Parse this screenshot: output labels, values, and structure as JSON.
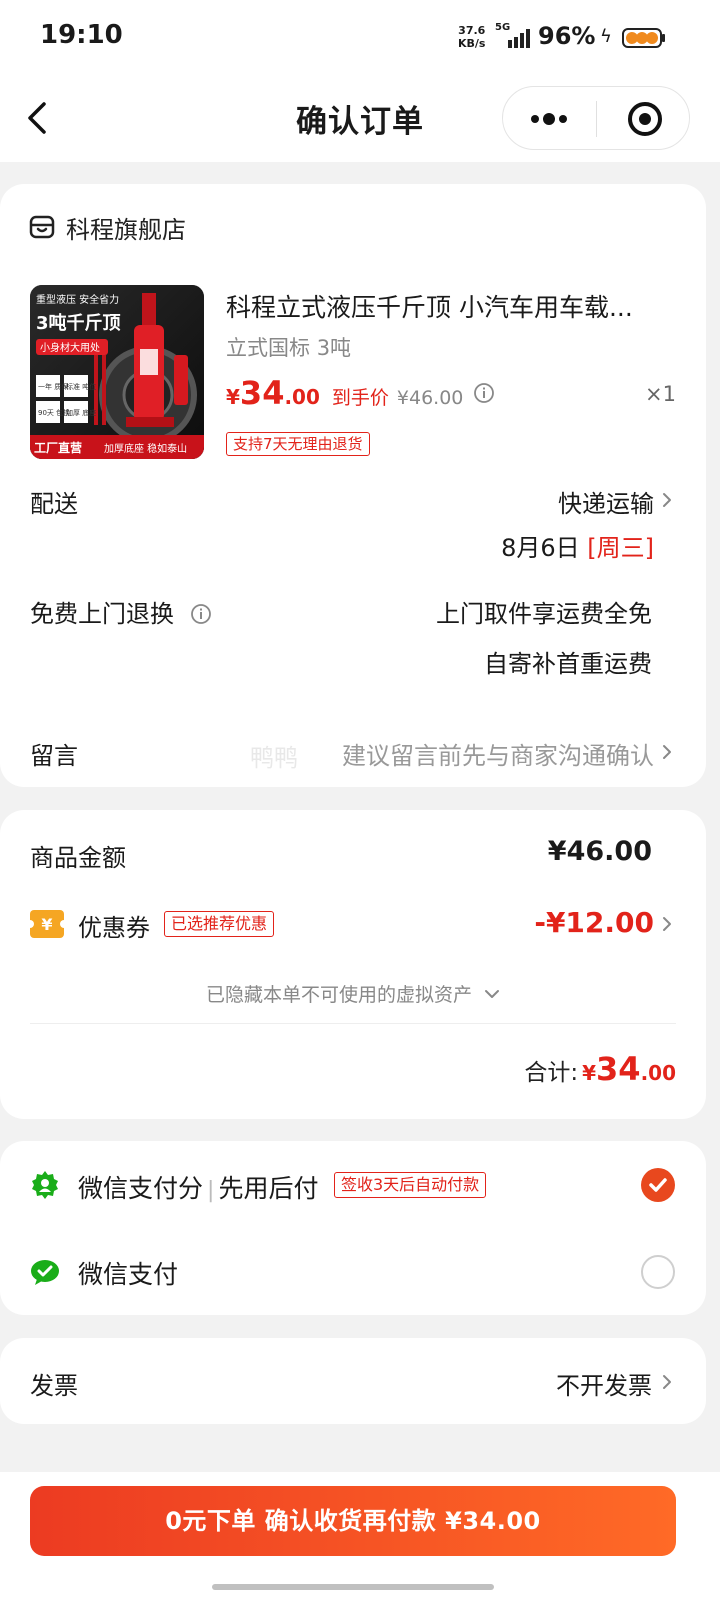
{
  "status_bar": {
    "time": "19:10",
    "net_speed_value": "37.6",
    "net_speed_unit": "KB/s",
    "network": "5G",
    "battery": "96%"
  },
  "nav": {
    "title": "确认订单",
    "more_icon": "more-dots-icon",
    "target_icon": "target-icon"
  },
  "shop": {
    "name": "科程旗舰店",
    "icon": "shop-icon"
  },
  "product": {
    "image_text": {
      "top": "重型液压 安全省力",
      "title": "3吨千斤顶",
      "sub": "小身材大用处",
      "f1": "一年\n质保",
      "f2": "标准\n吨位",
      "f3": "90天\n包换",
      "f4": "加厚\n底座",
      "banner_left": "工厂直营",
      "banner_right": "加厚底座 稳如泰山"
    },
    "title": "科程立式液压千斤顶 小汽车用车载...",
    "spec_prefix": "立式国标 ",
    "spec_bold": "3吨",
    "price_symbol": "¥",
    "price_int": "34",
    "price_dec": ".00",
    "final_price_label": "到手价",
    "final_price": "¥46.00",
    "quantity": "×1",
    "return_tag": "支持7天无理由退货"
  },
  "delivery": {
    "label": "配送",
    "method": "快递运输",
    "date": "8月6日",
    "weekday": "[周三]"
  },
  "free_return": {
    "label": "免费上门退换",
    "line1": "上门取件享运费全免",
    "line2": "自寄补首重运费"
  },
  "message": {
    "label": "留言",
    "placeholder": "建议留言前先与商家沟通确认",
    "watermark": "鸭鸭"
  },
  "amounts": {
    "goods_label": "商品金额",
    "goods_amount": "¥46.00",
    "coupon_label": "优惠券",
    "coupon_tag": "已选推荐优惠",
    "coupon_amount": "-¥12.00",
    "hidden_assets": "已隐藏本单不可使用的虚拟资产",
    "total_label": "合计:",
    "total_symbol": "¥",
    "total_int": "34",
    "total_dec": ".00"
  },
  "payment": {
    "option1": {
      "name": "微信支付分",
      "sub": "先用后付",
      "tag": "签收3天后自动付款",
      "selected": true
    },
    "option2": {
      "name": "微信支付",
      "selected": false
    }
  },
  "invoice": {
    "label": "发票",
    "value": "不开发票"
  },
  "submit": {
    "label": "0元下单 确认收货再付款 ¥34.00"
  },
  "colors": {
    "accent": "#e2231a",
    "button_start": "#ec3b22",
    "button_end": "#ff6a26",
    "wechat_green": "#1aad19"
  }
}
